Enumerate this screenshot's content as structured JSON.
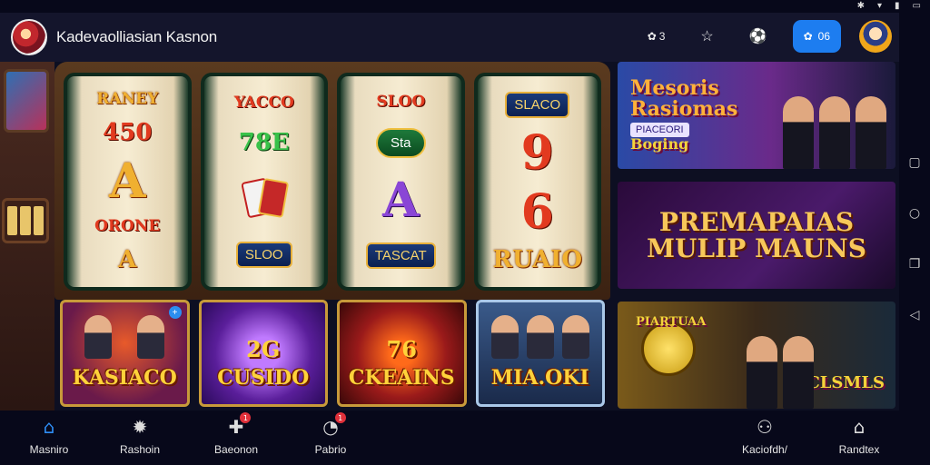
{
  "app": {
    "title": "Kadevaolliasian Kasnon"
  },
  "header": {
    "coins_badge": "3",
    "pill_value": "06"
  },
  "reels": [
    {
      "symbols": [
        "RANEY",
        "450",
        "A",
        "ORONE",
        "A"
      ]
    },
    {
      "symbols": [
        "YACCO",
        "78E",
        "SLOO"
      ]
    },
    {
      "symbols": [
        "SLOO",
        "Sta",
        "A",
        "TASCAT"
      ]
    },
    {
      "symbols": [
        "SLACO",
        "9",
        "6",
        "RUAIO"
      ]
    }
  ],
  "tiles": [
    {
      "label": "KASIACO",
      "top": ""
    },
    {
      "label": "CUSIDO",
      "top": "2G"
    },
    {
      "label": "CKEAINS",
      "top": "76"
    },
    {
      "label": "MIA.OKI",
      "top": ""
    }
  ],
  "promos": [
    {
      "title_line1": "Mesoris",
      "title_line2": "Rasiomas",
      "tag": "PIACEORI",
      "sub": "Boging"
    },
    {
      "title_line1": "PREMAPAIAS",
      "title_line2": "MULIP MAUNS"
    },
    {
      "title_line1": "PIARTUAA",
      "title_line2": "CLSMLS"
    }
  ],
  "bottom_nav": [
    {
      "label": "Masniro",
      "icon": "home-icon",
      "badge": ""
    },
    {
      "label": "Rashoin",
      "icon": "settings-icon",
      "badge": ""
    },
    {
      "label": "Baeonon",
      "icon": "gift-icon",
      "badge": "1"
    },
    {
      "label": "Pabrio",
      "icon": "chat-icon",
      "badge": "1"
    },
    {
      "label": "Kaciofdh/",
      "icon": "profile-icon",
      "badge": ""
    },
    {
      "label": "Randtex",
      "icon": "store-icon",
      "badge": ""
    }
  ],
  "colors": {
    "accent": "#1d7df0",
    "badge": "#e0303a",
    "gold": "#f0b030"
  }
}
